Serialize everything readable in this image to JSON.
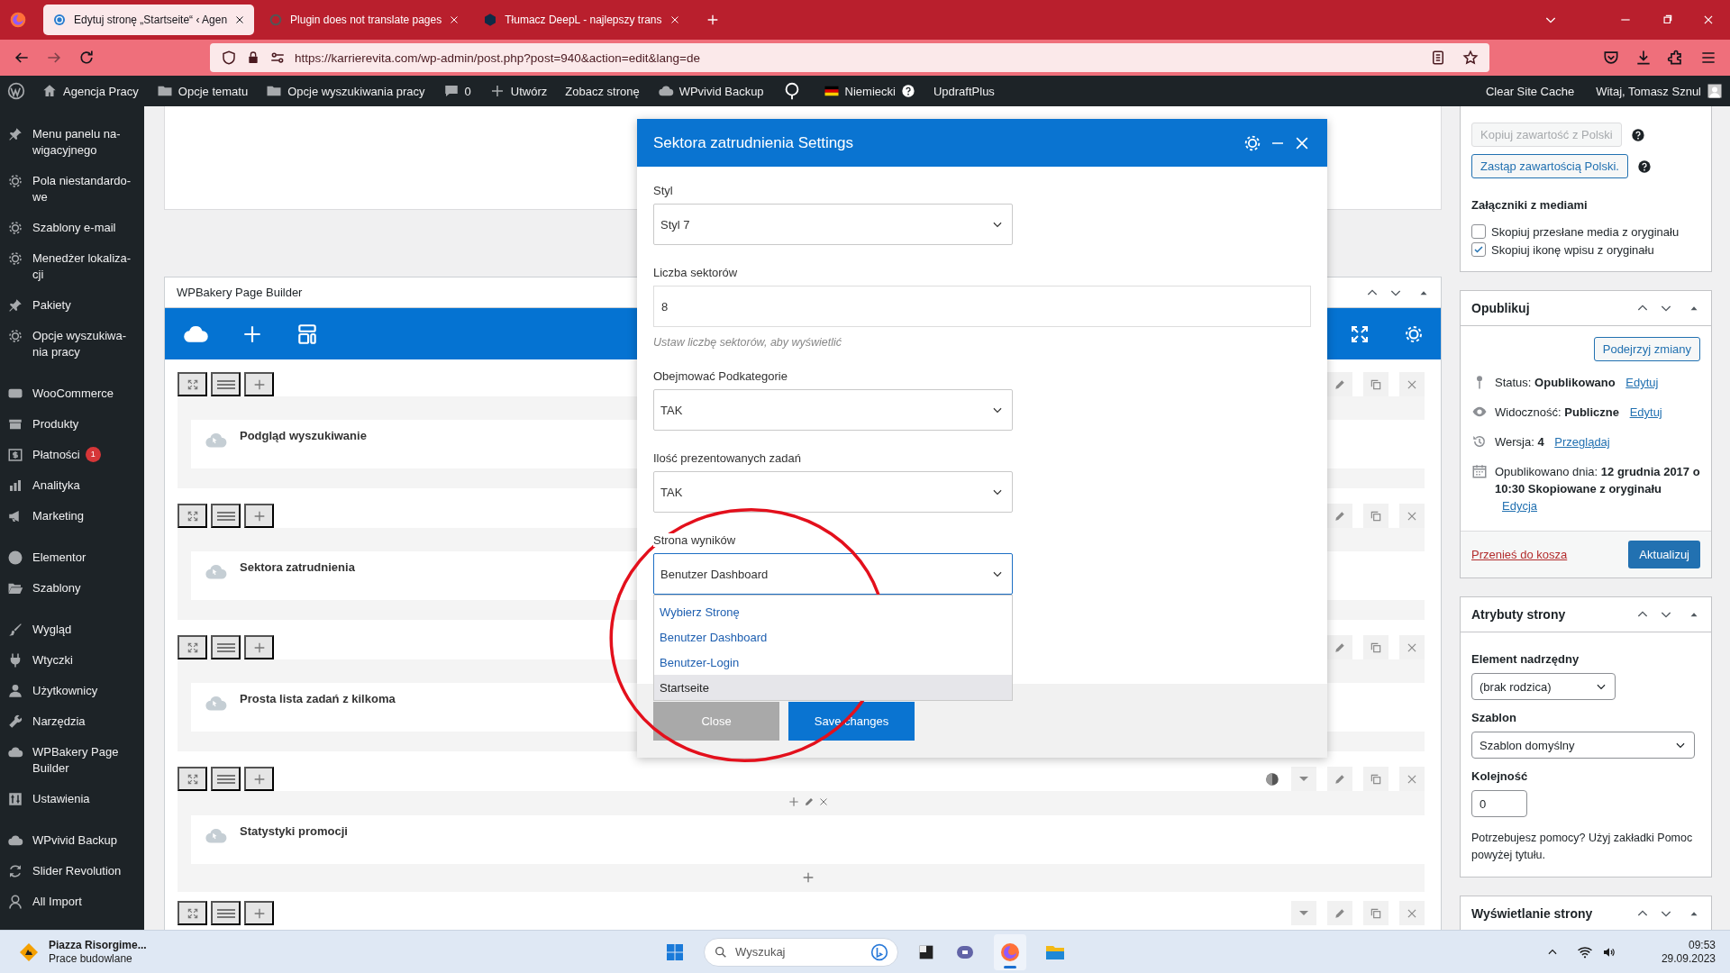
{
  "browser": {
    "tabs": [
      {
        "title": "Edytuj stronę „Startseite“ ‹ Agen",
        "selected": true
      },
      {
        "title": "Plugin does not translate pages",
        "selected": false
      },
      {
        "title": "Tłumacz DeepL - najlepszy trans",
        "selected": false
      }
    ],
    "url": "https://karrierevita.com/wp-admin/post.php?post=940&action=edit&lang=de"
  },
  "admin_bar": {
    "items": [
      {
        "label": "Agencja Pracy"
      },
      {
        "label": "Opcje tematu"
      },
      {
        "label": "Opcje wyszukiwania pracy"
      },
      {
        "label": "0"
      },
      {
        "label": "Utwórz"
      },
      {
        "label": "Zobacz stronę"
      },
      {
        "label": "WPvivid Backup"
      },
      {
        "label": "Niemiecki"
      },
      {
        "label": "UpdraftPlus"
      }
    ],
    "right": [
      {
        "label": "Clear Site Cache"
      },
      {
        "label": "Witaj, Tomasz Sznul"
      }
    ]
  },
  "sidebar": {
    "groups": [
      {
        "items": [
          {
            "label": "Menu panelu na-wigacyjnego"
          },
          {
            "label": "Pola niestandardo-we"
          },
          {
            "label": "Szablony e-mail"
          },
          {
            "label": "Menedżer lokaliza-cji"
          },
          {
            "label": "Pakiety"
          },
          {
            "label": "Opcje wyszukiwa-nia pracy"
          }
        ]
      },
      {
        "items": [
          {
            "label": "WooCommerce"
          },
          {
            "label": "Produkty"
          },
          {
            "label": "Płatności",
            "badge": "1"
          },
          {
            "label": "Analityka"
          },
          {
            "label": "Marketing"
          }
        ]
      },
      {
        "items": [
          {
            "label": "Elementor"
          },
          {
            "label": "Szablony"
          }
        ]
      },
      {
        "items": [
          {
            "label": "Wygląd"
          },
          {
            "label": "Wtyczki"
          },
          {
            "label": "Użytkownicy"
          },
          {
            "label": "Narzędzia"
          },
          {
            "label": "WPBakery Page Builder"
          },
          {
            "label": "Ustawienia"
          }
        ]
      },
      {
        "items": [
          {
            "label": "WPvivid Backup"
          },
          {
            "label": "Slider Revolution"
          },
          {
            "label": "All Import"
          }
        ]
      }
    ]
  },
  "builder": {
    "title": "WPBakery Page Builder",
    "rows": [
      {
        "kind": "plain",
        "element": "Podgląd wyszukiwanie"
      },
      {
        "kind": "plain",
        "element": "Sektora zatrudnienia"
      },
      {
        "kind": "plain",
        "element": "Prosta lista zadań z kilkoma"
      },
      {
        "kind": "section",
        "element": "Statystyki promocji"
      },
      {
        "kind": "partial"
      }
    ]
  },
  "modal": {
    "title": "Sektora zatrudnienia Settings",
    "fields": [
      {
        "kind": "select",
        "label": "Styl",
        "value": "Styl 7",
        "expanded": false
      },
      {
        "kind": "input",
        "label": "Liczba sektorów",
        "value": "8",
        "help": "Ustaw liczbę sektorów, aby wyświetlić"
      },
      {
        "kind": "select",
        "label": "Obejmować Podkategorie",
        "value": "TAK",
        "expanded": false
      },
      {
        "kind": "select",
        "label": "Ilość prezentowanych zadań",
        "value": "TAK",
        "expanded": false
      },
      {
        "kind": "select",
        "label": "Strona wyników",
        "value": "Benutzer Dashboard",
        "expanded": true,
        "options": [
          {
            "label": "Wybierz Stronę",
            "highlighted": false
          },
          {
            "label": "Benutzer Dashboard",
            "highlighted": false
          },
          {
            "label": "Benutzer-Login",
            "highlighted": false
          },
          {
            "label": "Startseite",
            "highlighted": true
          }
        ]
      }
    ],
    "buttons": [
      {
        "kind": "secondary",
        "label": "Close"
      },
      {
        "kind": "primary",
        "label": "Save changes"
      }
    ]
  },
  "right_panel": {
    "translation": {
      "buttons": [
        {
          "label": "Kopiuj zawartość z Polski",
          "disabled": true
        },
        {
          "label": "Zastąp zawartością Polski.",
          "disabled": false
        }
      ],
      "heading": "Załączniki z mediami",
      "checkboxes": [
        {
          "label": "Skopiuj przesłane media z oryginału",
          "checked": false
        },
        {
          "label": "Skopiuj ikonę wpisu z oryginału",
          "checked": true
        }
      ]
    },
    "publish": {
      "title": "Opublikuj",
      "preview_button": "Podejrzyj zmiany",
      "rows": [
        {
          "text": "Status: **Opublikowano**",
          "link": "Edytuj"
        },
        {
          "text": "Widoczność: **Publiczne**",
          "link": "Edytuj"
        },
        {
          "text": "Wersja: **4**",
          "link": "Przeglądaj"
        },
        {
          "text": "Opublikowano dnia: **12 grudnia 2017 o 10:30 Skopiowane z oryginału**",
          "link": "Edycja"
        }
      ],
      "trash_link": "Przenieś do kosza",
      "update_button": "Aktualizuj"
    },
    "attributes": {
      "title": "Atrybuty strony",
      "parent_label": "Element nadrzędny",
      "parent_value": "(brak rodzica)",
      "template_label": "Szablon",
      "template_value": "Szablon domyślny",
      "order_label": "Kolejność",
      "order_value": "0",
      "help": "Potrzebujesz pomocy? Użyj zakładki Pomoc powyżej tytułu."
    },
    "display": {
      "title": "Wyświetlanie strony"
    }
  },
  "taskbar": {
    "weather_title": "Piazza Risorgime...",
    "weather_subtitle": "Prace budowlane",
    "search_placeholder": "Wyszukaj",
    "time": "09:53",
    "date": "29.09.2023"
  }
}
